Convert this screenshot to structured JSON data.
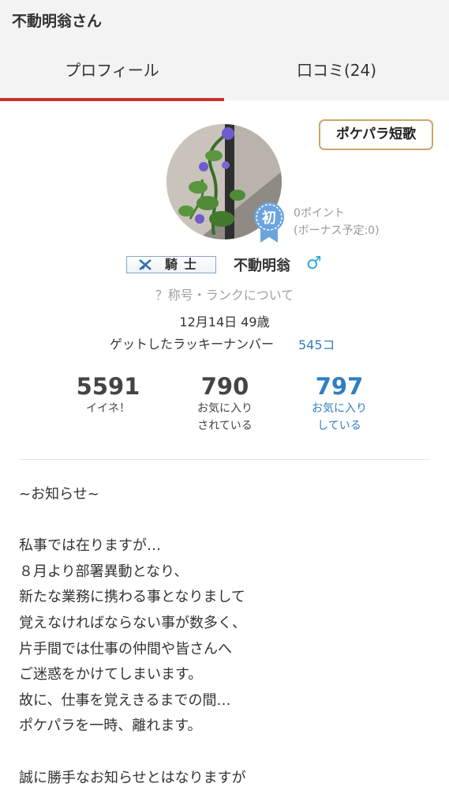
{
  "header": {
    "title": "不動明翁さん",
    "tabs": [
      {
        "label": "プロフィール",
        "active": true
      },
      {
        "label": "口コミ(24)",
        "active": false
      }
    ],
    "active_color": "#c8302f"
  },
  "profile": {
    "tanka_button": "ポケパラ短歌",
    "initial_badge": "初",
    "points": "0ポイント",
    "bonus": "(ボーナス予定:0)",
    "rank_title": "騎士",
    "rank_icon": "crossed-swords-icon",
    "username": "不動明翁",
    "gender_icon": "♂",
    "rank_link": "？称号・ランクについて",
    "birthday_age": "12月14日 49歳",
    "lucky_label": "ゲットしたラッキーナンバー",
    "lucky_value": "545コ"
  },
  "stats": [
    {
      "value": "5591",
      "label_line1": "イイネ！",
      "label_line2": ""
    },
    {
      "value": "790",
      "label_line1": "お気に入り",
      "label_line2": "されている"
    },
    {
      "value": "797",
      "label_line1": "お気に入り",
      "label_line2": "している"
    }
  ],
  "notice_lines": [
    "~お知らせ~",
    "",
    "私事では在りますが…",
    "８月より部署異動となり、",
    "新たな業務に携わる事となりまして",
    "覚えなければならない事が数多く、",
    "片手間では仕事の仲間や皆さんへ",
    "ご迷惑をかけてしまいます。",
    "故に、仕事を覚えきるまでの間…",
    "ポケパラを一時、離れます。",
    "",
    "誠に勝手なお知らせとはなりますが"
  ]
}
